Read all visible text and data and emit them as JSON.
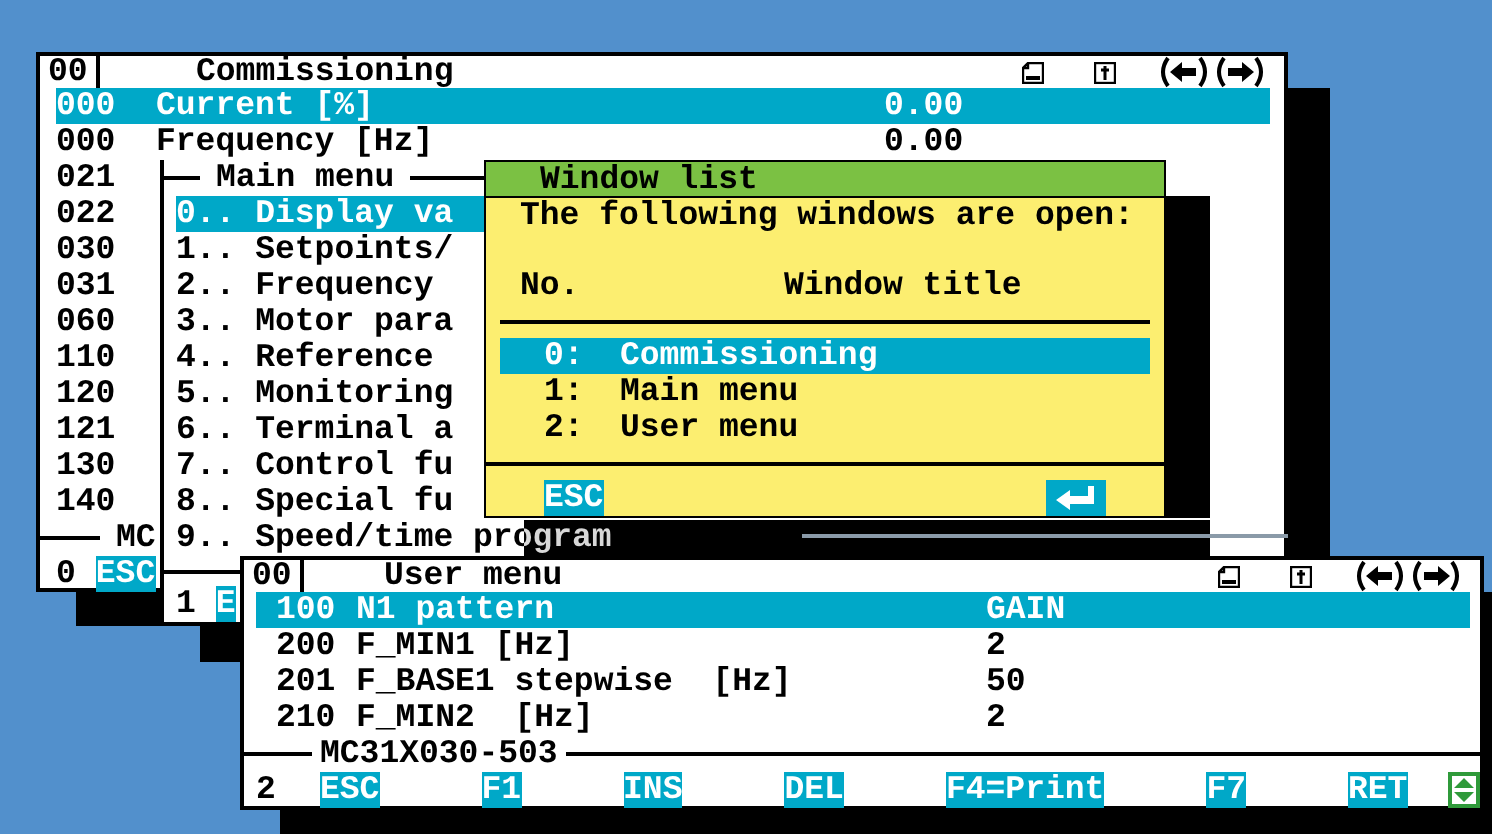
{
  "commissioning": {
    "number": "00",
    "title": "Commissioning",
    "rows": [
      {
        "code": "000",
        "label": "Current [%]",
        "value": "0.00",
        "selected": true
      },
      {
        "code": "000",
        "label": "Frequency [Hz]",
        "value": "0.00",
        "selected": false
      },
      {
        "code": "021",
        "selected": false
      },
      {
        "code": "022",
        "selected": false
      },
      {
        "code": "030",
        "selected": false
      },
      {
        "code": "031",
        "selected": false
      },
      {
        "code": "060",
        "selected": false
      },
      {
        "code": "110",
        "selected": false
      },
      {
        "code": "120",
        "selected": false
      },
      {
        "code": "121",
        "selected": false
      },
      {
        "code": "130",
        "selected": false
      },
      {
        "code": "140",
        "selected": false
      }
    ],
    "footer_label": "MC",
    "window_index": "0",
    "keys": [
      {
        "label": "ESC"
      }
    ]
  },
  "main_menu": {
    "title": "Main menu",
    "items": [
      {
        "text": "0.. Display va",
        "selected": true
      },
      {
        "text": "1.. Setpoints/",
        "selected": false
      },
      {
        "text": "2.. Frequency",
        "selected": false
      },
      {
        "text": "3.. Motor para",
        "selected": false
      },
      {
        "text": "4.. Reference",
        "selected": false
      },
      {
        "text": "5.. Monitoring",
        "selected": false
      },
      {
        "text": "6.. Terminal a",
        "selected": false
      },
      {
        "text": "7.. Control fu",
        "selected": false
      },
      {
        "text": "8.. Special fu",
        "selected": false
      },
      {
        "text": "9.. Speed/time program",
        "selected": false
      }
    ],
    "window_index": "1",
    "keys": [
      {
        "label": "E"
      }
    ]
  },
  "window_list": {
    "title": "Window list",
    "message": "The following windows are open:",
    "columns": [
      "No.",
      "Window title"
    ],
    "items": [
      {
        "number": "0:",
        "title": "Commissioning",
        "selected": true
      },
      {
        "number": "1:",
        "title": "Main menu",
        "selected": false
      },
      {
        "number": "2:",
        "title": "User menu",
        "selected": false
      }
    ],
    "keys": [
      {
        "label": "ESC"
      }
    ]
  },
  "user_menu": {
    "number": "00",
    "title": "User menu",
    "rows": [
      {
        "code": "100",
        "label": "N1 pattern",
        "value": "GAIN",
        "selected": true
      },
      {
        "code": "200",
        "label": "F_MIN1 [Hz]",
        "value": "2",
        "selected": false
      },
      {
        "code": "201",
        "label": "F_BASE1 stepwise  [Hz]",
        "value": "50",
        "selected": false
      },
      {
        "code": "210",
        "label": "F_MIN2  [Hz]",
        "value": "2",
        "selected": false
      }
    ],
    "footer_label": "MC31X030-503",
    "window_index": "2",
    "keys": [
      {
        "label": "ESC"
      },
      {
        "label": "F1"
      },
      {
        "label": "INS"
      },
      {
        "label": "DEL"
      },
      {
        "label": "F4=Print"
      },
      {
        "label": "F7"
      },
      {
        "label": "RET"
      }
    ]
  }
}
